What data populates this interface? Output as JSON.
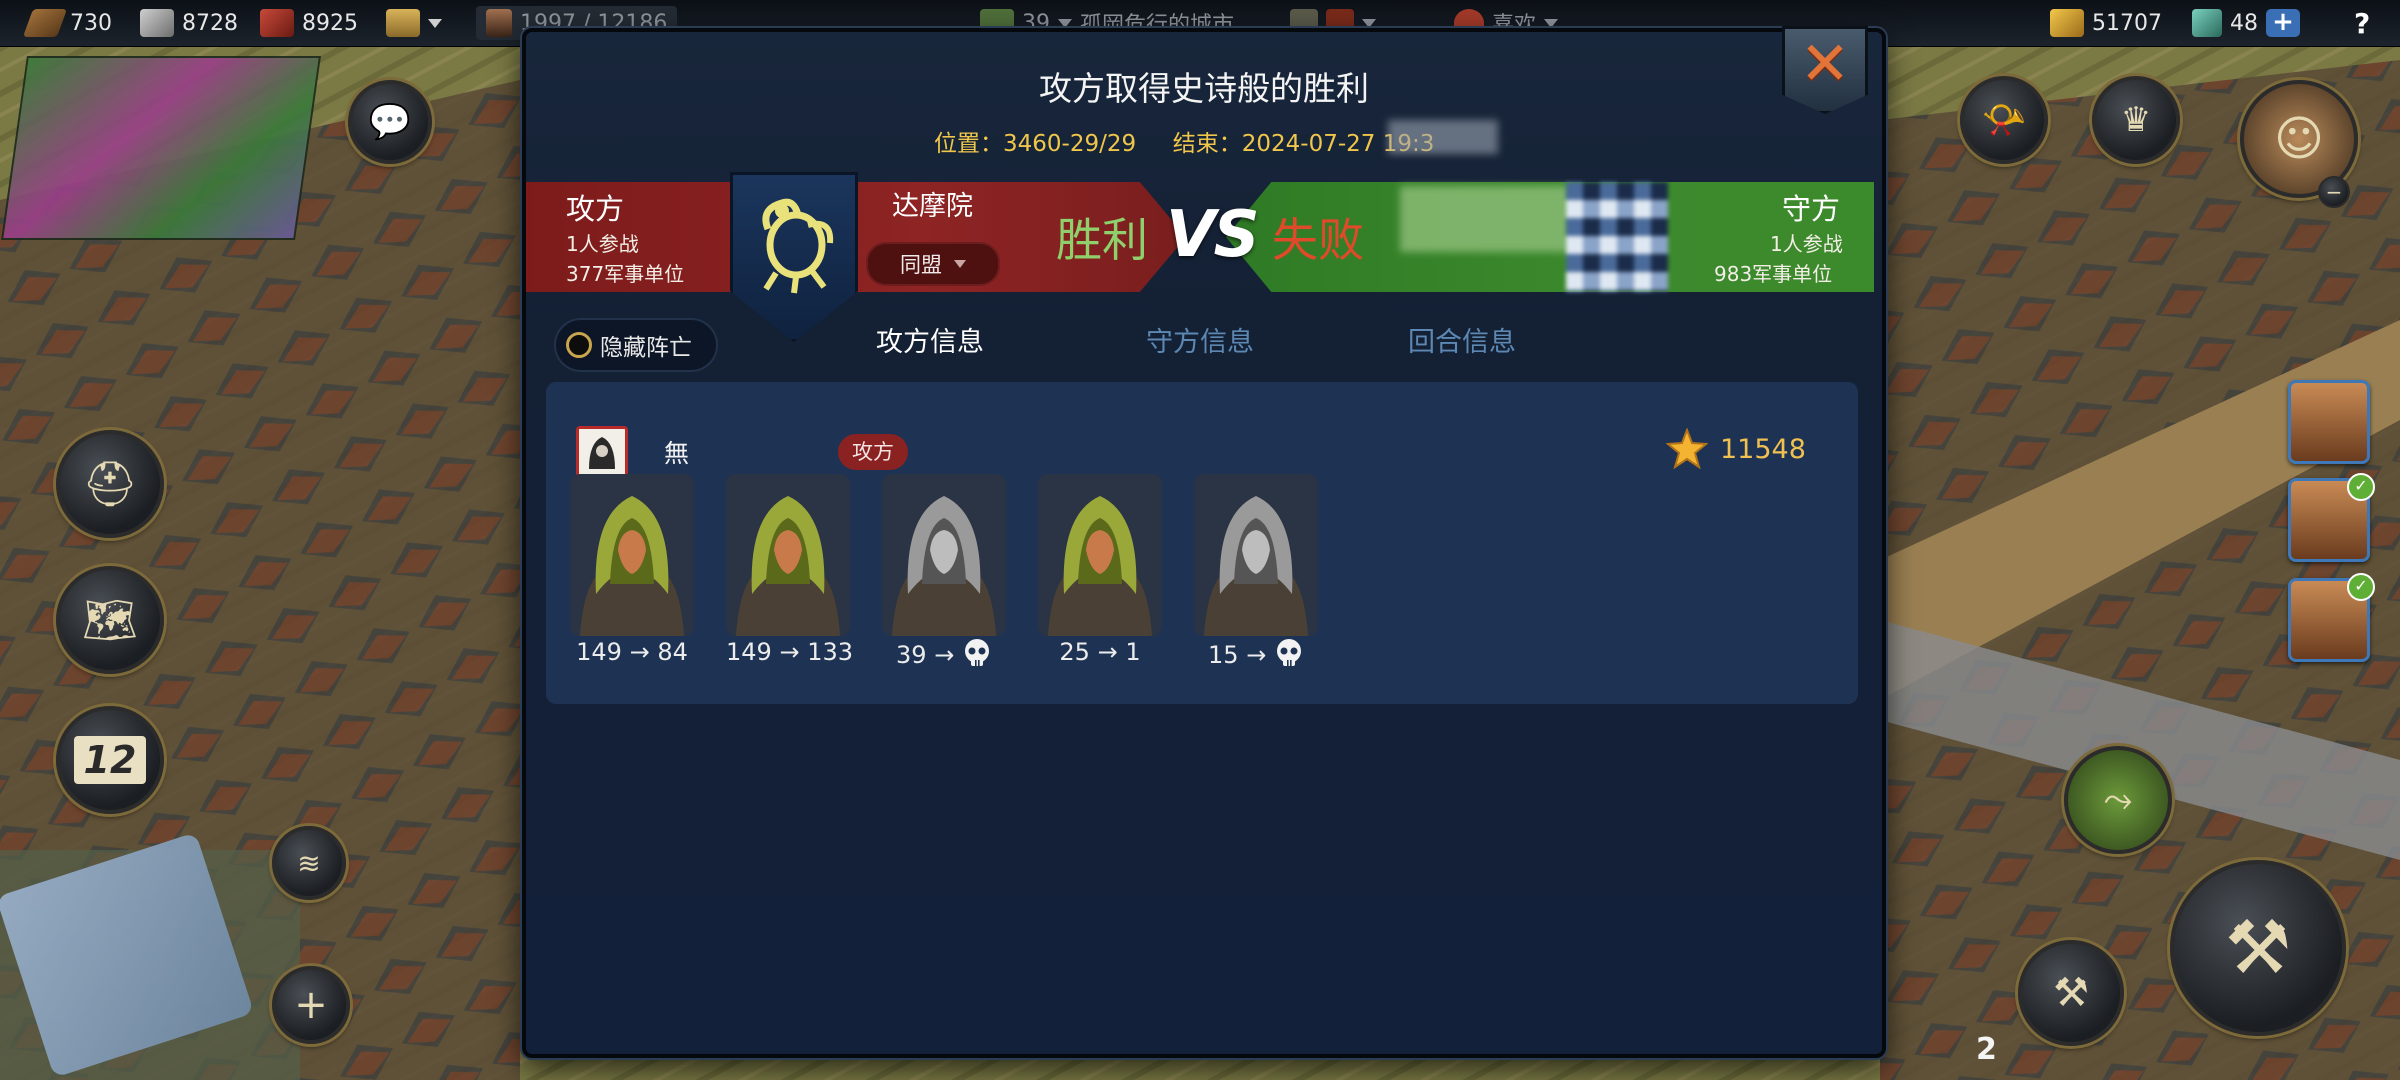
{
  "topbar": {
    "wood": "730",
    "stone": "8728",
    "iron": "8925",
    "population": "1997 / 12186",
    "rank": "39",
    "city_name": "孤岡危行的城市",
    "like": "喜欢",
    "gold": "51707",
    "gems": "48",
    "help": "?"
  },
  "side": {
    "calendar_day": "12",
    "notice_num": "2"
  },
  "battle": {
    "title": "攻方取得史诗般的胜利",
    "location_label": "位置：",
    "location": "3460-29/29",
    "end_label": "结束：",
    "end_time": "2024-07-27 19:3",
    "attacker": {
      "label": "攻方",
      "participants": "1人参战",
      "units": "377军事单位",
      "alliance": "达摩院",
      "alliance_tag": "同盟",
      "result": "胜利"
    },
    "vs": "VS",
    "defender": {
      "label": "守方",
      "participants": "1人参战",
      "units": "983军事单位",
      "result": "失败"
    },
    "hide_dead": "隐藏阵亡",
    "tabs": [
      "攻方信息",
      "守方信息",
      "回合信息"
    ],
    "player": {
      "name": "無",
      "role": "攻方",
      "score": "11548"
    },
    "units_list": [
      {
        "from": "149",
        "to": "84",
        "hood": "green"
      },
      {
        "from": "149",
        "to": "133",
        "hood": "green"
      },
      {
        "from": "39",
        "to": "",
        "hood": "gray"
      },
      {
        "from": "25",
        "to": "1",
        "hood": "green"
      },
      {
        "from": "15",
        "to": "",
        "hood": "gray"
      }
    ],
    "arrow": "→"
  },
  "colors": {
    "attacker_red": "#8e2424",
    "defender_green": "#3d8a2d",
    "victory_text": "#8fcf6c",
    "defeat_text": "#e04a2a",
    "gold_text": "#f0c64b",
    "tab_active": "#ffffff",
    "tab_inactive": "#5c88b3"
  }
}
